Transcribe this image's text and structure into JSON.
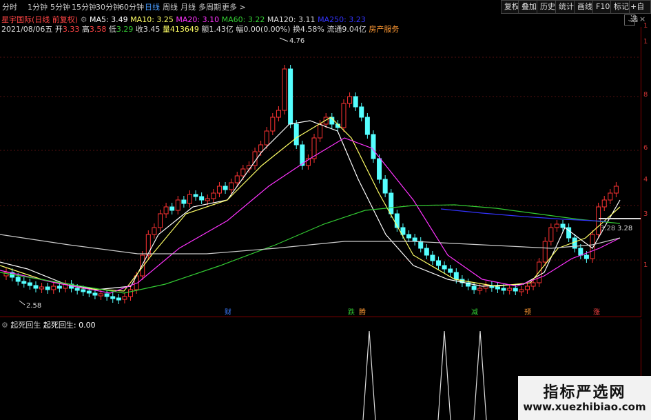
{
  "toolbar": {
    "timeframes": [
      "分时",
      "1分钟",
      "5分钟",
      "15分钟",
      "30分钟",
      "60分钟",
      "日线",
      "周线",
      "月线",
      "多周期",
      "更多"
    ],
    "active": "日线",
    "right_buttons": [
      "复权",
      "叠加",
      "历史",
      "统计",
      "画线",
      "F10",
      "标记",
      "+自选"
    ]
  },
  "header": {
    "stock_title": "星宇国际(日线 前复权)",
    "ma": [
      {
        "label": "MA5: 3.49",
        "color": "#ffffff"
      },
      {
        "label": "MA10: 3.25",
        "color": "#ffff66"
      },
      {
        "label": "MA20: 3.10",
        "color": "#ff33ff"
      },
      {
        "label": "MA60: 3.22",
        "color": "#33cc33"
      },
      {
        "label": "MA120: 3.11",
        "color": "#dddddd"
      },
      {
        "label": "MA250: 3.23",
        "color": "#3333ff"
      }
    ],
    "info": [
      {
        "label": "2021/08/06五",
        "color": "#dddddd"
      },
      {
        "label": "开",
        "color": "#dddddd"
      },
      {
        "label": "3.33",
        "color": "#ff4444"
      },
      {
        "label": "高",
        "color": "#dddddd"
      },
      {
        "label": "3.58",
        "color": "#ff4444"
      },
      {
        "label": "低",
        "color": "#dddddd"
      },
      {
        "label": "3.29",
        "color": "#33cc33"
      },
      {
        "label": "收3.45",
        "color": "#dddddd"
      },
      {
        "label": "量413649",
        "color": "#ffff66"
      },
      {
        "label": "额1.43亿",
        "color": "#dddddd"
      },
      {
        "label": "幅0.00(0.00%)",
        "color": "#dddddd"
      },
      {
        "label": "换4.58%",
        "color": "#dddddd"
      },
      {
        "label": "流通9.04亿",
        "color": "#dddddd"
      },
      {
        "label": "房产服务",
        "color": "#ff9933"
      }
    ]
  },
  "price_labels": {
    "high": "4.76",
    "low": "2.58",
    "current": "3.28",
    "current_left": "3.28"
  },
  "y_ticks": [
    "1",
    "3",
    "4",
    "6",
    "8",
    "1",
    "1"
  ],
  "signals": [
    {
      "text": "财",
      "color": "#3a7bff"
    },
    {
      "text": "跌",
      "color": "#33cc33"
    },
    {
      "text": "腾",
      "color": "#ff9933"
    },
    {
      "text": "减",
      "color": "#33cc33"
    },
    {
      "text": "预",
      "color": "#ff9933"
    },
    {
      "text": "涨",
      "color": "#ff4444"
    }
  ],
  "indicator": {
    "name": "起死回生",
    "value_label": "起死回生: 0.00"
  },
  "watermark": {
    "title": "指标严选网",
    "url": "www.xuezhibiao.com"
  }
}
